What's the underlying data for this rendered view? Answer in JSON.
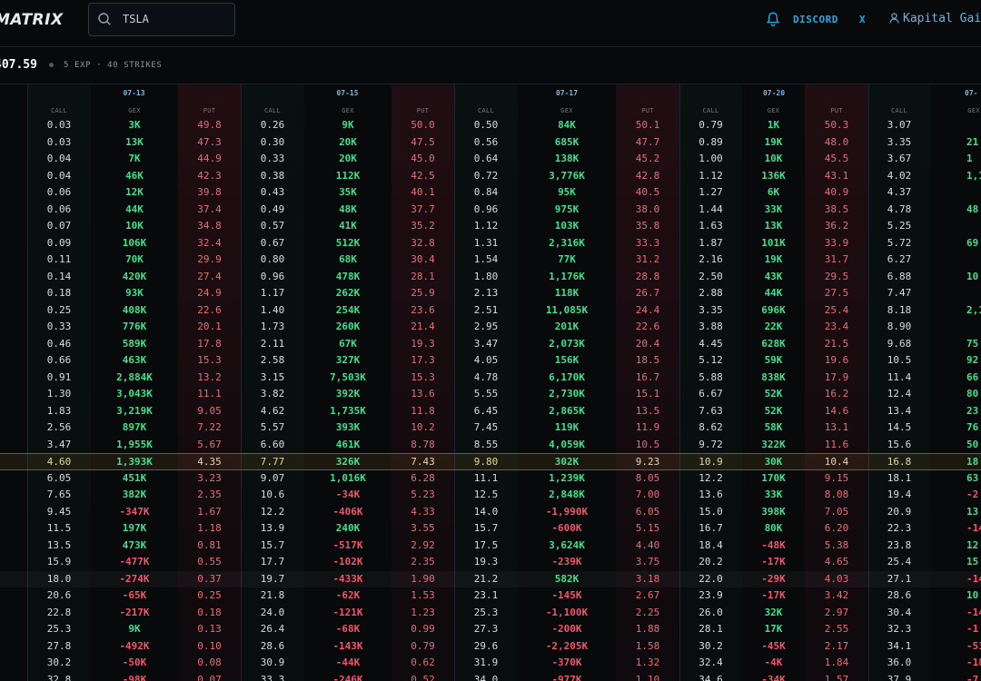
{
  "header": {
    "logo": "MATRIX",
    "search_value": "TSLA",
    "discord": "DISCORD",
    "x_label": "X",
    "user": "Kapital Gai"
  },
  "info": {
    "price": "407.59",
    "meta": "5 EXP · 40 STRIKES"
  },
  "colors": {
    "accent": "#29a8e0",
    "positive": "#3fe08e",
    "negative": "#f0566a",
    "put": "#e0707a",
    "atm_line": "#7a5a1c"
  },
  "grid": {
    "column_labels": {
      "call": "CALL",
      "gex": "GEX",
      "put": "PUT"
    },
    "expirations": [
      {
        "date": "07-13",
        "rows": [
          [
            "0.03",
            "3K",
            "49.8"
          ],
          [
            "0.03",
            "13K",
            "47.3"
          ],
          [
            "0.04",
            "7K",
            "44.9"
          ],
          [
            "0.04",
            "46K",
            "42.3"
          ],
          [
            "0.06",
            "12K",
            "39.8"
          ],
          [
            "0.06",
            "44K",
            "37.4"
          ],
          [
            "0.07",
            "10K",
            "34.8"
          ],
          [
            "0.09",
            "106K",
            "32.4"
          ],
          [
            "0.11",
            "70K",
            "29.9"
          ],
          [
            "0.14",
            "420K",
            "27.4"
          ],
          [
            "0.18",
            "93K",
            "24.9"
          ],
          [
            "0.25",
            "408K",
            "22.6"
          ],
          [
            "0.33",
            "776K",
            "20.1"
          ],
          [
            "0.46",
            "589K",
            "17.8"
          ],
          [
            "0.66",
            "463K",
            "15.3"
          ],
          [
            "0.91",
            "2,884K",
            "13.2"
          ],
          [
            "1.30",
            "3,043K",
            "11.1"
          ],
          [
            "1.83",
            "3,219K",
            "9.05"
          ],
          [
            "2.56",
            "897K",
            "7.22"
          ],
          [
            "3.47",
            "1,955K",
            "5.67"
          ],
          [
            "4.60",
            "1,393K",
            "4.35"
          ],
          [
            "6.05",
            "451K",
            "3.23"
          ],
          [
            "7.65",
            "382K",
            "2.35"
          ],
          [
            "9.45",
            "-347K",
            "1.67"
          ],
          [
            "11.5",
            "197K",
            "1.18"
          ],
          [
            "13.5",
            "473K",
            "0.81"
          ],
          [
            "15.9",
            "-477K",
            "0.55"
          ],
          [
            "18.0",
            "-274K",
            "0.37"
          ],
          [
            "20.6",
            "-65K",
            "0.25"
          ],
          [
            "22.8",
            "-217K",
            "0.18"
          ],
          [
            "25.3",
            "9K",
            "0.13"
          ],
          [
            "27.8",
            "-492K",
            "0.10"
          ],
          [
            "30.2",
            "-50K",
            "0.08"
          ],
          [
            "32.8",
            "-98K",
            "0.07"
          ]
        ]
      },
      {
        "date": "07-15",
        "rows": [
          [
            "0.26",
            "9K",
            "50.0"
          ],
          [
            "0.30",
            "20K",
            "47.5"
          ],
          [
            "0.33",
            "20K",
            "45.0"
          ],
          [
            "0.38",
            "112K",
            "42.5"
          ],
          [
            "0.43",
            "35K",
            "40.1"
          ],
          [
            "0.49",
            "48K",
            "37.7"
          ],
          [
            "0.57",
            "41K",
            "35.2"
          ],
          [
            "0.67",
            "512K",
            "32.8"
          ],
          [
            "0.80",
            "68K",
            "30.4"
          ],
          [
            "0.96",
            "478K",
            "28.1"
          ],
          [
            "1.17",
            "262K",
            "25.9"
          ],
          [
            "1.40",
            "254K",
            "23.6"
          ],
          [
            "1.73",
            "260K",
            "21.4"
          ],
          [
            "2.11",
            "67K",
            "19.3"
          ],
          [
            "2.58",
            "327K",
            "17.3"
          ],
          [
            "3.15",
            "7,503K",
            "15.3"
          ],
          [
            "3.82",
            "392K",
            "13.6"
          ],
          [
            "4.62",
            "1,735K",
            "11.8"
          ],
          [
            "5.57",
            "393K",
            "10.2"
          ],
          [
            "6.60",
            "461K",
            "8.78"
          ],
          [
            "7.77",
            "326K",
            "7.43"
          ],
          [
            "9.07",
            "1,016K",
            "6.28"
          ],
          [
            "10.6",
            "-34K",
            "5.23"
          ],
          [
            "12.2",
            "-406K",
            "4.33"
          ],
          [
            "13.9",
            "240K",
            "3.55"
          ],
          [
            "15.7",
            "-517K",
            "2.92"
          ],
          [
            "17.7",
            "-102K",
            "2.35"
          ],
          [
            "19.7",
            "-433K",
            "1.90"
          ],
          [
            "21.8",
            "-62K",
            "1.53"
          ],
          [
            "24.0",
            "-121K",
            "1.23"
          ],
          [
            "26.4",
            "-68K",
            "0.99"
          ],
          [
            "28.6",
            "-143K",
            "0.79"
          ],
          [
            "30.9",
            "-44K",
            "0.62"
          ],
          [
            "33.3",
            "-246K",
            "0.52"
          ]
        ]
      },
      {
        "date": "07-17",
        "rows": [
          [
            "0.50",
            "84K",
            "50.1"
          ],
          [
            "0.56",
            "685K",
            "47.7"
          ],
          [
            "0.64",
            "138K",
            "45.2"
          ],
          [
            "0.72",
            "3,776K",
            "42.8"
          ],
          [
            "0.84",
            "95K",
            "40.5"
          ],
          [
            "0.96",
            "975K",
            "38.0"
          ],
          [
            "1.12",
            "103K",
            "35.8"
          ],
          [
            "1.31",
            "2,316K",
            "33.3"
          ],
          [
            "1.54",
            "77K",
            "31.2"
          ],
          [
            "1.80",
            "1,176K",
            "28.8"
          ],
          [
            "2.13",
            "118K",
            "26.7"
          ],
          [
            "2.51",
            "11,085K",
            "24.4"
          ],
          [
            "2.95",
            "201K",
            "22.6"
          ],
          [
            "3.47",
            "2,073K",
            "20.4"
          ],
          [
            "4.05",
            "156K",
            "18.5"
          ],
          [
            "4.78",
            "6,170K",
            "16.7"
          ],
          [
            "5.55",
            "2,730K",
            "15.1"
          ],
          [
            "6.45",
            "2,865K",
            "13.5"
          ],
          [
            "7.45",
            "119K",
            "11.9"
          ],
          [
            "8.55",
            "4,059K",
            "10.5"
          ],
          [
            "9.80",
            "302K",
            "9.23"
          ],
          [
            "11.1",
            "1,239K",
            "8.05"
          ],
          [
            "12.5",
            "2,848K",
            "7.00"
          ],
          [
            "14.0",
            "-1,990K",
            "6.05"
          ],
          [
            "15.7",
            "-600K",
            "5.15"
          ],
          [
            "17.5",
            "3,624K",
            "4.40"
          ],
          [
            "19.3",
            "-239K",
            "3.75"
          ],
          [
            "21.2",
            "582K",
            "3.18"
          ],
          [
            "23.1",
            "-145K",
            "2.67"
          ],
          [
            "25.3",
            "-1,100K",
            "2.25"
          ],
          [
            "27.3",
            "-200K",
            "1.88"
          ],
          [
            "29.6",
            "-2,205K",
            "1.58"
          ],
          [
            "31.9",
            "-370K",
            "1.32"
          ],
          [
            "34.0",
            "-977K",
            "1.10"
          ]
        ]
      },
      {
        "date": "07-20",
        "rows": [
          [
            "0.79",
            "1K",
            "50.3"
          ],
          [
            "0.89",
            "19K",
            "48.0"
          ],
          [
            "1.00",
            "10K",
            "45.5"
          ],
          [
            "1.12",
            "136K",
            "43.1"
          ],
          [
            "1.27",
            "6K",
            "40.9"
          ],
          [
            "1.44",
            "33K",
            "38.5"
          ],
          [
            "1.63",
            "13K",
            "36.2"
          ],
          [
            "1.87",
            "101K",
            "33.9"
          ],
          [
            "2.16",
            "19K",
            "31.7"
          ],
          [
            "2.50",
            "43K",
            "29.5"
          ],
          [
            "2.88",
            "44K",
            "27.5"
          ],
          [
            "3.35",
            "696K",
            "25.4"
          ],
          [
            "3.88",
            "22K",
            "23.4"
          ],
          [
            "4.45",
            "628K",
            "21.5"
          ],
          [
            "5.12",
            "59K",
            "19.6"
          ],
          [
            "5.88",
            "838K",
            "17.9"
          ],
          [
            "6.67",
            "52K",
            "16.2"
          ],
          [
            "7.63",
            "52K",
            "14.6"
          ],
          [
            "8.62",
            "58K",
            "13.1"
          ],
          [
            "9.72",
            "322K",
            "11.6"
          ],
          [
            "10.9",
            "30K",
            "10.4"
          ],
          [
            "12.2",
            "170K",
            "9.15"
          ],
          [
            "13.6",
            "33K",
            "8.08"
          ],
          [
            "15.0",
            "398K",
            "7.05"
          ],
          [
            "16.7",
            "80K",
            "6.20"
          ],
          [
            "18.4",
            "-48K",
            "5.38"
          ],
          [
            "20.2",
            "-17K",
            "4.65"
          ],
          [
            "22.0",
            "-29K",
            "4.03"
          ],
          [
            "23.9",
            "-17K",
            "3.42"
          ],
          [
            "26.0",
            "32K",
            "2.97"
          ],
          [
            "28.1",
            "17K",
            "2.55"
          ],
          [
            "30.2",
            "-45K",
            "2.17"
          ],
          [
            "32.4",
            "-4K",
            "1.84"
          ],
          [
            "34.6",
            "-34K",
            "1.57"
          ]
        ]
      },
      {
        "date": "07-",
        "rows": [
          [
            "3.07",
            ""
          ],
          [
            "3.35",
            "21"
          ],
          [
            "3.67",
            "1"
          ],
          [
            "4.02",
            "1,1"
          ],
          [
            "4.37",
            ""
          ],
          [
            "4.78",
            "48"
          ],
          [
            "5.25",
            ""
          ],
          [
            "5.72",
            "69"
          ],
          [
            "6.27",
            ""
          ],
          [
            "6.88",
            "10"
          ],
          [
            "7.47",
            ""
          ],
          [
            "8.18",
            "2,1"
          ],
          [
            "8.90",
            ""
          ],
          [
            "9.68",
            "75"
          ],
          [
            "10.5",
            "92"
          ],
          [
            "11.4",
            "66"
          ],
          [
            "12.4",
            "80"
          ],
          [
            "13.4",
            "23"
          ],
          [
            "14.5",
            "76"
          ],
          [
            "15.6",
            "50"
          ],
          [
            "16.8",
            "18"
          ],
          [
            "18.1",
            "63"
          ],
          [
            "19.4",
            "-2"
          ],
          [
            "20.9",
            "13"
          ],
          [
            "22.3",
            "-14"
          ],
          [
            "23.8",
            "12"
          ],
          [
            "25.4",
            "15"
          ],
          [
            "27.1",
            "-14"
          ],
          [
            "28.6",
            "10"
          ],
          [
            "30.4",
            "-14"
          ],
          [
            "32.3",
            "-1"
          ],
          [
            "34.1",
            "-53"
          ],
          [
            "36.0",
            "-18"
          ],
          [
            "37.9",
            "-7"
          ]
        ]
      }
    ]
  }
}
